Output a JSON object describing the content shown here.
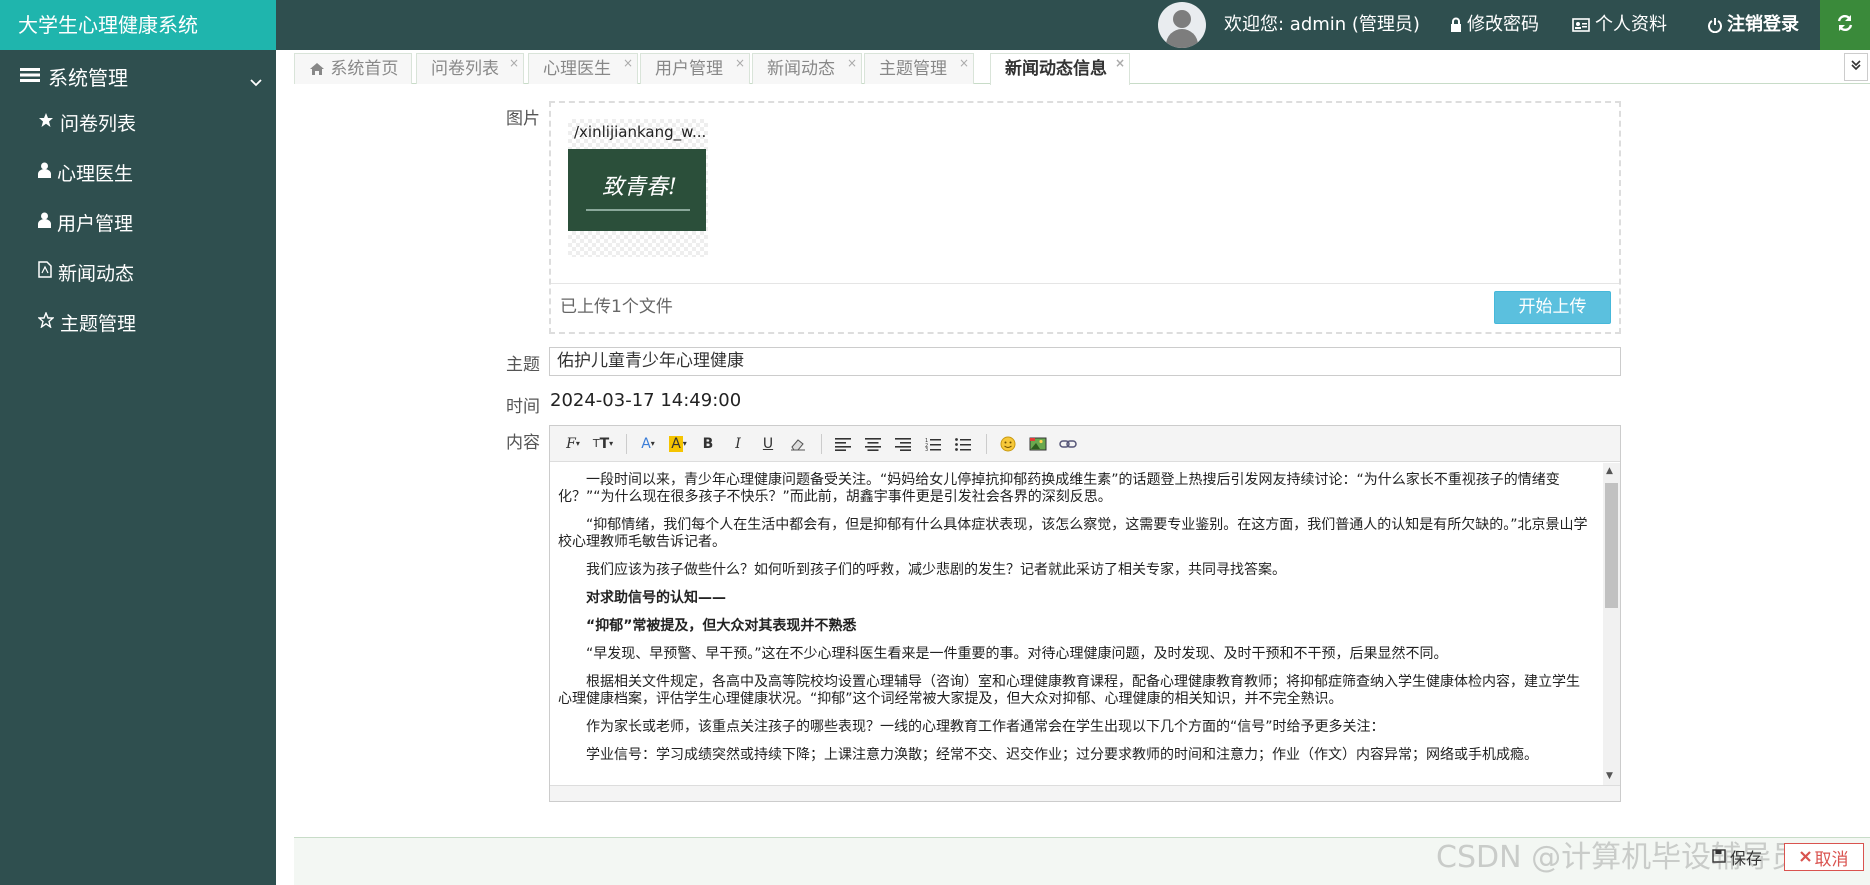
{
  "app": {
    "title": "大学生心理健康系统"
  },
  "header": {
    "welcome": "欢迎您: admin (管理员)",
    "change_password": "修改密码",
    "profile": "个人资料",
    "logout": "注销登录"
  },
  "sidebar": {
    "group_label": "系统管理",
    "items": [
      {
        "label": "问卷列表",
        "icon": "star-icon"
      },
      {
        "label": "心理医生",
        "icon": "user-icon"
      },
      {
        "label": "用户管理",
        "icon": "user-icon"
      },
      {
        "label": "新闻动态",
        "icon": "document-icon"
      },
      {
        "label": "主题管理",
        "icon": "star-outline-icon"
      }
    ]
  },
  "tabs": [
    {
      "label": "系统首页"
    },
    {
      "label": "问卷列表"
    },
    {
      "label": "心理医生"
    },
    {
      "label": "用户管理"
    },
    {
      "label": "新闻动态"
    },
    {
      "label": "主题管理"
    },
    {
      "label": "新闻动态信息",
      "active": true
    }
  ],
  "form": {
    "image_label": "图片",
    "file_name": "/xinlijiankang_w...",
    "thumbnail_text": "致青春!",
    "upload_count": "已上传1个文件",
    "upload_button": "开始上传",
    "subject_label": "主题",
    "subject_value": "佑护儿童青少年心理健康",
    "time_label": "时间",
    "time_value": "2024-03-17 14:49:00",
    "content_label": "内容"
  },
  "content": {
    "paragraphs": [
      {
        "text": "一段时间以来，青少年心理健康问题备受关注。“妈妈给女儿停掉抗抑郁药换成维生素”的话题登上热搜后引发网友持续讨论：“为什么家长不重视孩子的情绪变化？”“为什么现在很多孩子不快乐？”而此前，胡鑫宇事件更是引发社会各界的深刻反思。",
        "bold": false
      },
      {
        "text": "“抑郁情绪，我们每个人在生活中都会有，但是抑郁有什么具体症状表现，该怎么察觉，这需要专业鉴别。在这方面，我们普通人的认知是有所欠缺的。”北京景山学校心理教师毛敏告诉记者。",
        "bold": false
      },
      {
        "text": "我们应该为孩子做些什么？如何听到孩子们的呼救，减少悲剧的发生？记者就此采访了相关专家，共同寻找答案。",
        "bold": false
      },
      {
        "text": "对求助信号的认知——",
        "bold": true
      },
      {
        "text": "“抑郁”常被提及，但大众对其表现并不熟悉",
        "bold": true
      },
      {
        "text": "“早发现、早预警、早干预。”这在不少心理科医生看来是一件重要的事。对待心理健康问题，及时发现、及时干预和不干预，后果显然不同。",
        "bold": false
      },
      {
        "text": "根据相关文件规定，各高中及高等院校均设置心理辅导（咨询）室和心理健康教育课程，配备心理健康教育教师；将抑郁症筛查纳入学生健康体检内容，建立学生心理健康档案，评估学生心理健康状况。“抑郁”这个词经常被大家提及，但大众对抑郁、心理健康的相关知识，并不完全熟识。",
        "bold": false
      },
      {
        "text": "作为家长或老师，该重点关注孩子的哪些表现？一线的心理教育工作者通常会在学生出现以下几个方面的“信号”时给予更多关注：",
        "bold": false
      },
      {
        "text": "学业信号：学习成绩突然或持续下降；上课注意力涣散；经常不交、迟交作业；过分要求教师的时间和注意力；作业（作文）内容异常；网络或手机成瘾。",
        "bold": false
      }
    ]
  },
  "footer": {
    "save": "保存",
    "cancel": "取消",
    "watermark": "CSDN @计算机毕设辅导员"
  },
  "colors": {
    "brand": "#1fb5ad",
    "sidebar": "#2f4f4f",
    "refresh": "#3a8a3a",
    "upload": "#5bc0de",
    "cancel": "#d9534f"
  }
}
